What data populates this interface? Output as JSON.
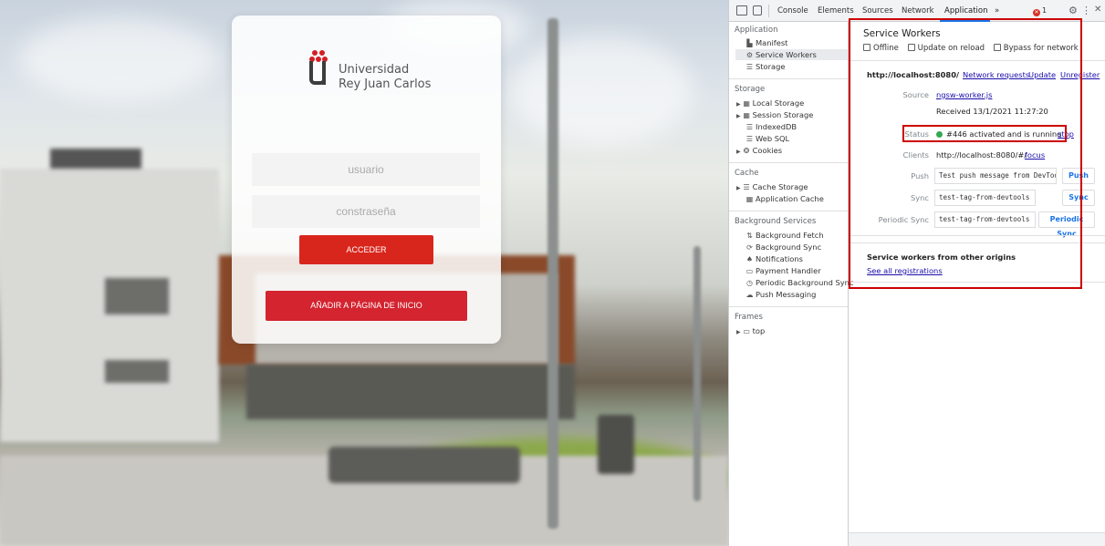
{
  "login": {
    "logo_line1": "Universidad",
    "logo_line2": "Rey Juan Carlos",
    "username_placeholder": "usuario",
    "password_placeholder": "constraseña",
    "submit_label": "ACCEDER",
    "add_home_label": "AÑADIR A PÁGINA DE INICIO",
    "brand_color": "#d9261c"
  },
  "devtools": {
    "toolbar": {
      "tabs": [
        "Console",
        "Elements",
        "Sources",
        "Network",
        "Application",
        "»"
      ],
      "active_tab": "Application",
      "error_count": "1"
    },
    "sidebar": {
      "application_section": "Application",
      "application_items": [
        "Manifest",
        "Service Workers",
        "Storage"
      ],
      "storage_section": "Storage",
      "storage_items": [
        "Local Storage",
        "Session Storage",
        "IndexedDB",
        "Web SQL",
        "Cookies"
      ],
      "cache_section": "Cache",
      "cache_items": [
        "Cache Storage",
        "Application Cache"
      ],
      "bg_section": "Background Services",
      "bg_items": [
        "Background Fetch",
        "Background Sync",
        "Notifications",
        "Payment Handler",
        "Periodic Background Sync",
        "Push Messaging"
      ],
      "frames_section": "Frames",
      "frames_items": [
        "top"
      ]
    },
    "service_workers": {
      "title": "Service Workers",
      "options": [
        "Offline",
        "Update on reload",
        "Bypass for network"
      ],
      "origin": "http://localhost:8080/",
      "links": {
        "network_requests": "Network requests",
        "update": "Update",
        "unregister": "Unregister"
      },
      "source_label": "Source",
      "source_file": "ngsw-worker.js",
      "received": "Received 13/1/2021 11:27:20",
      "status_label": "Status",
      "status_text": "#446 activated and is running",
      "status_action": "stop",
      "clients_label": "Clients",
      "clients_value": "http://localhost:8080/#/",
      "clients_action": "focus",
      "push_label": "Push",
      "push_value": "Test push message from DevTools.",
      "push_button": "Push",
      "sync_label": "Sync",
      "sync_value": "test-tag-from-devtools",
      "sync_button": "Sync",
      "periodic_label": "Periodic Sync",
      "periodic_value": "test-tag-from-devtools",
      "periodic_button": "Periodic Sync",
      "other_origins_title": "Service workers from other origins",
      "see_all": "See all registrations"
    },
    "highlight_color": "#cc0000"
  }
}
